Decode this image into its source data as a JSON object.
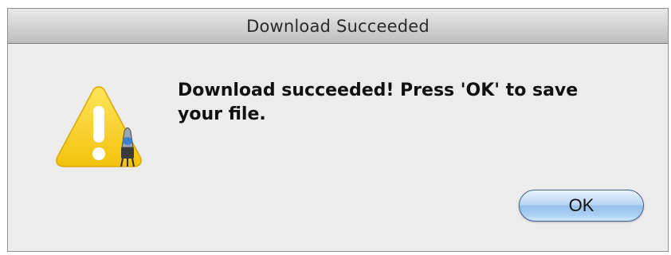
{
  "window": {
    "title": "Download Succeeded"
  },
  "alert": {
    "icon": "warning-triangle-icon",
    "message": "Download succeeded! Press 'OK' to save your file."
  },
  "buttons": {
    "ok_label": "OK"
  },
  "colors": {
    "accent": "#97c0ec",
    "warning": "#f5d21f",
    "background": "#ececec"
  }
}
